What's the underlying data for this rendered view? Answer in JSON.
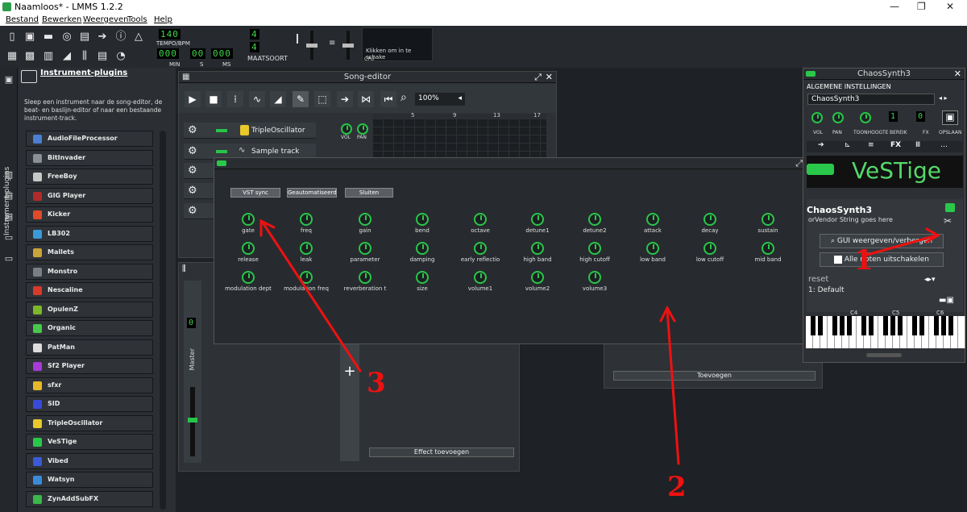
{
  "app": {
    "title": "Naamloos* - LMMS 1.2.2"
  },
  "menu": [
    "Bestand",
    "Bewerken",
    "Weergeven",
    "Tools",
    "Help"
  ],
  "toolbar": {
    "tempo_value": "140",
    "tempo_label": "TEMPO/BPM",
    "time_min": "000",
    "time_s": "00",
    "time_ms": "000",
    "lbl_min": "MIN",
    "lbl_s": "S",
    "lbl_ms": "MS",
    "sig_top": "4",
    "sig_bottom": "4",
    "sig_label": "MAATSOORT",
    "cpu_text": "Klikken om in te schake",
    "cpu_label": "CPU"
  },
  "sidebar": {
    "tab_label": "Instrument-plugins"
  },
  "plugins": {
    "title": "Instrument-plugins",
    "description": "Sleep een instrument naar de song-editor, de beat- en baslijn-editor of naar een bestaande instrument-track.",
    "items": [
      {
        "label": "AudioFileProcessor",
        "color": "#4a7fd1"
      },
      {
        "label": "BitInvader",
        "color": "#8a8f96"
      },
      {
        "label": "FreeBoy",
        "color": "#c8c8c8"
      },
      {
        "label": "GIG Player",
        "color": "#b02a2a"
      },
      {
        "label": "Kicker",
        "color": "#e04a2a"
      },
      {
        "label": "LB302",
        "color": "#3a9ad8"
      },
      {
        "label": "Mallets",
        "color": "#c9a43a"
      },
      {
        "label": "Monstro",
        "color": "#7a7f86"
      },
      {
        "label": "Nescaline",
        "color": "#d83a2a"
      },
      {
        "label": "OpulenZ",
        "color": "#7ab82a"
      },
      {
        "label": "Organic",
        "color": "#48c84a"
      },
      {
        "label": "PatMan",
        "color": "#dddddd"
      },
      {
        "label": "Sf2 Player",
        "color": "#a83ad8"
      },
      {
        "label": "sfxr",
        "color": "#e8b82a"
      },
      {
        "label": "SID",
        "color": "#3a4ad8"
      },
      {
        "label": "TripleOscillator",
        "color": "#e8c82a"
      },
      {
        "label": "VeSTige",
        "color": "#2ac84a"
      },
      {
        "label": "Vibed",
        "color": "#3a5ad8"
      },
      {
        "label": "Watsyn",
        "color": "#3a8ad8"
      },
      {
        "label": "ZynAddSubFX",
        "color": "#3ab84a"
      }
    ]
  },
  "song_editor": {
    "title": "Song-editor",
    "zoom": "100%",
    "ruler": [
      "5",
      "9",
      "13",
      "17"
    ],
    "tracks": [
      {
        "name": "TripleOscillator"
      },
      {
        "name": "Sample track"
      }
    ],
    "knob_labels": [
      "VOL",
      "PAN"
    ]
  },
  "mixer": {
    "master_label": "Master",
    "lcd": "0",
    "add_effect": "Effect toevoegen"
  },
  "fx_panel": {
    "add": "Toevoegen"
  },
  "vst": {
    "buttons": [
      "VST sync",
      "Geautomatiseerd",
      "Sluiten"
    ],
    "params": [
      [
        "gate",
        "freq",
        "gain",
        "bend",
        "octave",
        "detune1",
        "detune2",
        "attack",
        "decay",
        "sustain"
      ],
      [
        "release",
        "leak",
        "parameter",
        "damping",
        "early reflectio",
        "high band",
        "high cutoff",
        "low band",
        "low cutoff",
        "mid band"
      ],
      [
        "modulation dept",
        "modulation freq",
        "reverberation t",
        "size",
        "volume1",
        "volume2",
        "volume3"
      ]
    ]
  },
  "chaos": {
    "title": "ChaosSynth3",
    "section": "ALGEMENE INSTELLINGEN",
    "name_value": "ChaosSynth3",
    "knob_labels": [
      "VOL",
      "PAN",
      "TOONHOOGTE",
      "BEREIK",
      "FX",
      "OPSLAAN"
    ],
    "bereik_lcd": "1",
    "fx_lcd": "0",
    "tabs": [
      "FX",
      "Ⅲ",
      "…"
    ],
    "logo": "VeSTige",
    "plugin_name": "ChaosSynth3",
    "vendor": "orVendor String goes here",
    "gui_btn": "GUI weergeven/verbergen",
    "notes_btn": "Alle noten uitschakelen",
    "preset_label": "reset",
    "preset_value": "1: Default",
    "keys": [
      "C4",
      "C5",
      "C6"
    ]
  },
  "annotations": [
    "1",
    "2",
    "3"
  ]
}
